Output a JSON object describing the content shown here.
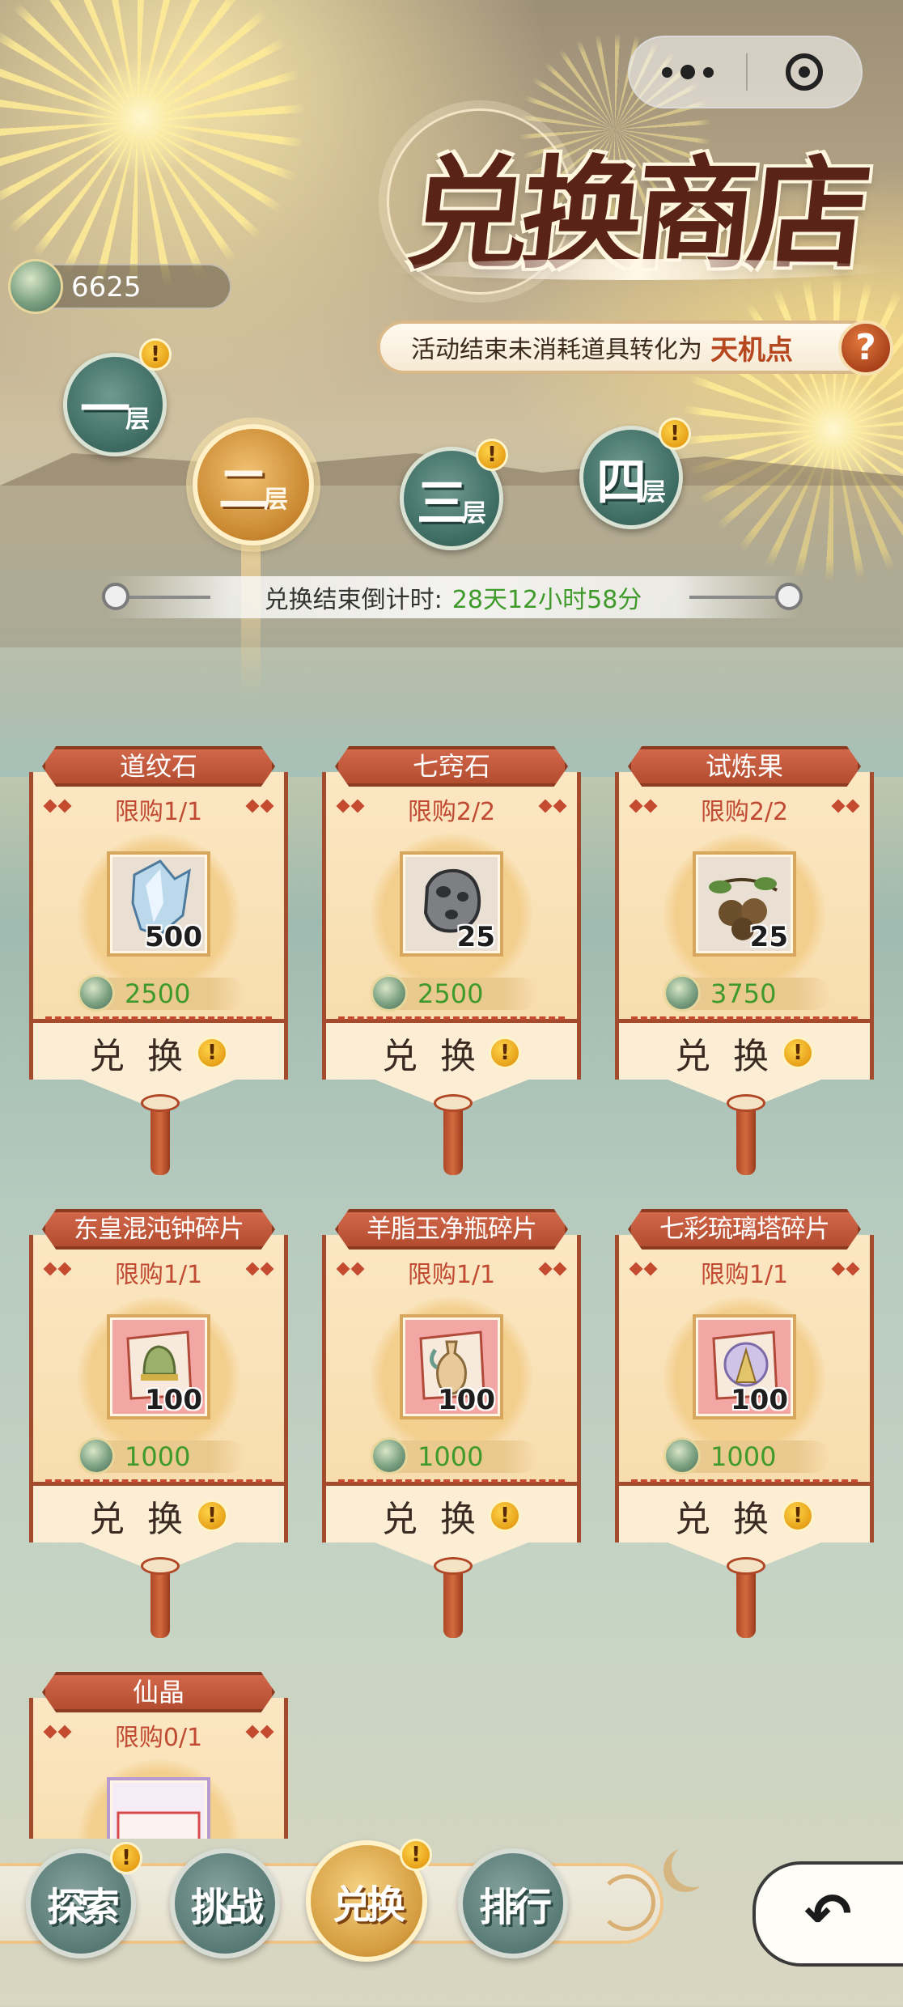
{
  "shop": {
    "title": "兑换商店",
    "note_text": "活动结束未消耗道具转化为",
    "note_highlight": "天机点",
    "help_label": "?"
  },
  "currency": {
    "amount": "6625",
    "icon": "jade-coin-icon"
  },
  "capsule": {
    "more_icon": "more-dots-icon",
    "close_icon": "close-target-icon"
  },
  "tiers": [
    {
      "main": "一",
      "sub": "层",
      "active": false,
      "badge": "!"
    },
    {
      "main": "二",
      "sub": "层",
      "active": true,
      "badge": ""
    },
    {
      "main": "三",
      "sub": "层",
      "active": false,
      "badge": "!"
    },
    {
      "main": "四",
      "sub": "层",
      "active": false,
      "badge": "!"
    }
  ],
  "countdown": {
    "label": "兑换结束倒计时:",
    "value": "28天12小时58分"
  },
  "items": [
    {
      "name": "道纹石",
      "limit": "限购1/1",
      "count": "500",
      "price": "2500",
      "button": "兑换",
      "badge": "!",
      "icon": "crystal-shard-icon"
    },
    {
      "name": "七窍石",
      "limit": "限购2/2",
      "count": "25",
      "price": "2500",
      "button": "兑换",
      "badge": "!",
      "icon": "stone-icon"
    },
    {
      "name": "试炼果",
      "limit": "限购2/2",
      "count": "25",
      "price": "3750",
      "button": "兑换",
      "badge": "!",
      "icon": "fruit-icon"
    },
    {
      "name": "东皇混沌钟碎片",
      "limit": "限购1/1",
      "count": "100",
      "price": "1000",
      "button": "兑换",
      "badge": "!",
      "icon": "bell-fragment-icon"
    },
    {
      "name": "羊脂玉净瓶碎片",
      "limit": "限购1/1",
      "count": "100",
      "price": "1000",
      "button": "兑换",
      "badge": "!",
      "icon": "vase-fragment-icon"
    },
    {
      "name": "七彩琉璃塔碎片",
      "limit": "限购1/1",
      "count": "100",
      "price": "1000",
      "button": "兑换",
      "badge": "!",
      "icon": "pagoda-fragment-icon"
    },
    {
      "name": "仙晶",
      "limit": "限购0/1",
      "count": "",
      "price": "",
      "button": "",
      "badge": "",
      "icon": "immortal-crystal-icon"
    }
  ],
  "nav": [
    {
      "label": "探索",
      "active": false,
      "badge": "!"
    },
    {
      "label": "挑战",
      "active": false,
      "badge": ""
    },
    {
      "label": "兑换",
      "active": true,
      "badge": "!"
    },
    {
      "label": "排行",
      "active": false,
      "badge": ""
    }
  ],
  "back": {
    "icon": "back-arrow-icon",
    "label": "↶"
  },
  "colors": {
    "accent_red": "#a34b2c",
    "price_green": "#3f9a2b",
    "highlight_orange": "#b6471e",
    "card_bg": "#fbe7c3"
  }
}
